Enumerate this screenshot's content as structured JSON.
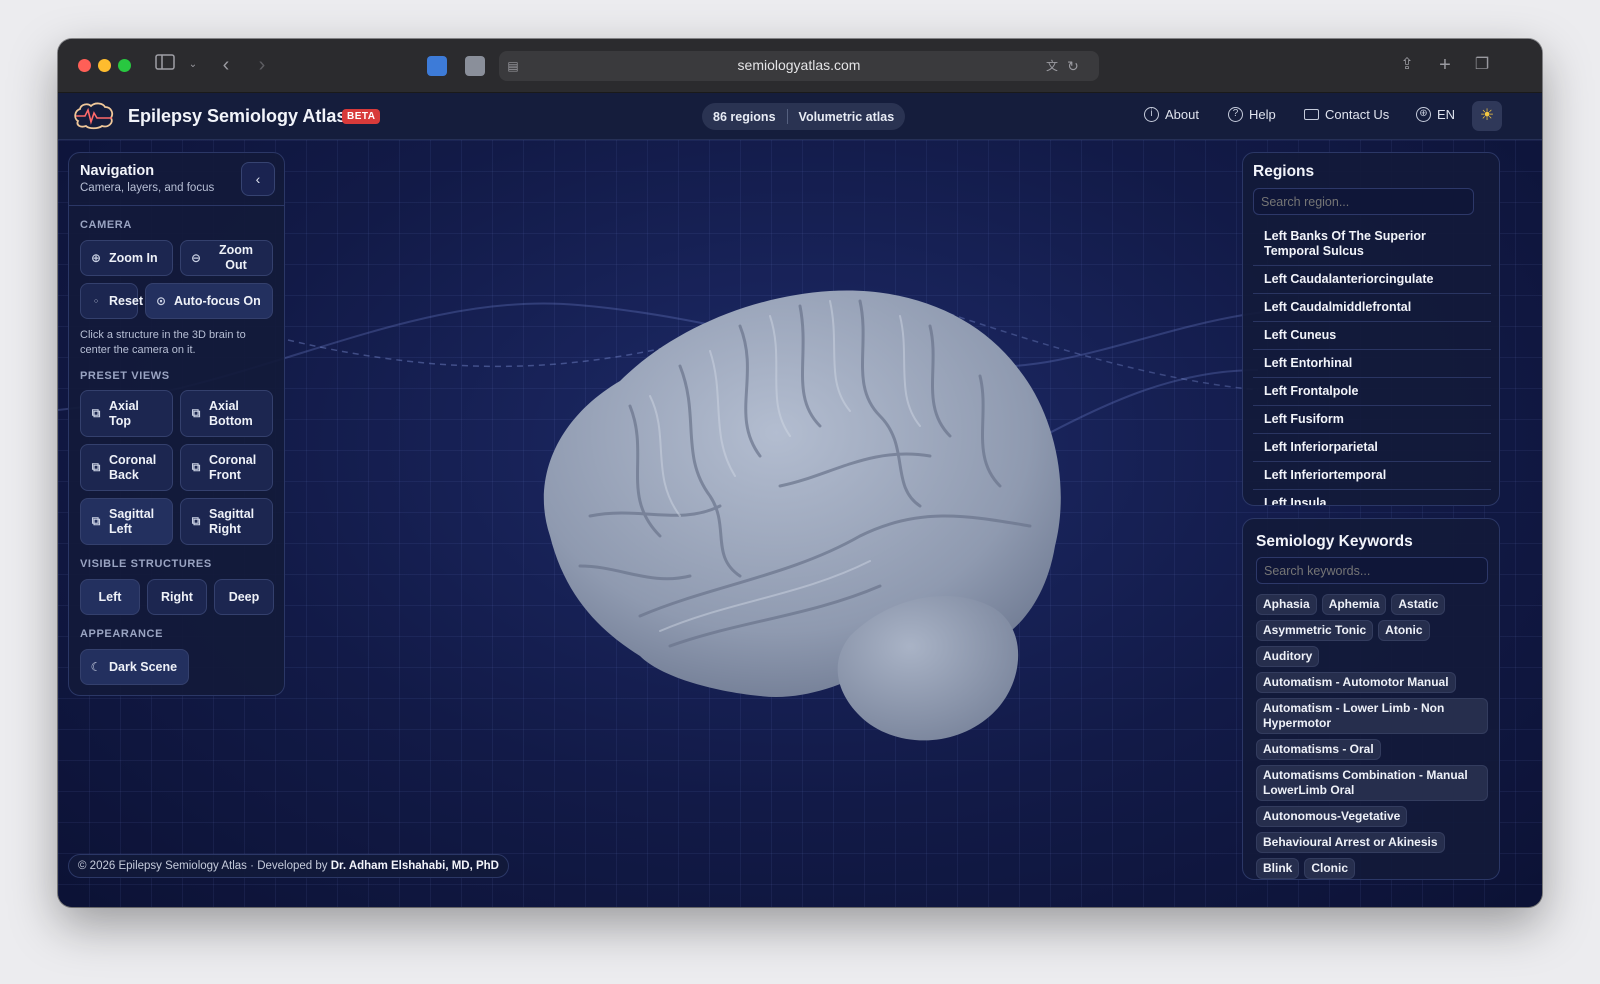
{
  "browser": {
    "url": "semiologyatlas.com"
  },
  "app": {
    "title": "Epilepsy Semiology Atlas",
    "badge": "BETA",
    "stats": {
      "regions": "86 regions",
      "mode": "Volumetric atlas"
    },
    "nav": {
      "about": "About",
      "help": "Help",
      "contact": "Contact Us",
      "language": "EN"
    }
  },
  "navigation_panel": {
    "title": "Navigation",
    "subtitle": "Camera, layers, and focus",
    "camera": {
      "label": "CAMERA",
      "zoom_in": "Zoom In",
      "zoom_out_1": "Zoom",
      "zoom_out_2": "Out",
      "reset": "Reset",
      "autofocus": "Auto-focus On",
      "hint": "Click a structure in the 3D brain to center the camera on it."
    },
    "preset_views": {
      "label": "PRESET VIEWS",
      "axial_top": [
        "Axial",
        "Top"
      ],
      "axial_bottom": [
        "Axial",
        "Bottom"
      ],
      "coronal_back": [
        "Coronal",
        "Back"
      ],
      "coronal_front": [
        "Coronal",
        "Front"
      ],
      "sagittal_left": [
        "Sagittal",
        "Left"
      ],
      "sagittal_right": [
        "Sagittal",
        "Right"
      ]
    },
    "visible_structures": {
      "label": "VISIBLE STRUCTURES",
      "left": "Left",
      "right": "Right",
      "deep": "Deep"
    },
    "appearance": {
      "label": "APPEARANCE",
      "dark_scene": "Dark Scene"
    }
  },
  "regions_panel": {
    "title": "Regions",
    "search_placeholder": "Search region...",
    "items": [
      "Left Banks Of The Superior Temporal Sulcus",
      "Left Caudalanteriorcingulate",
      "Left Caudalmiddlefrontal",
      "Left Cuneus",
      "Left Entorhinal",
      "Left Frontalpole",
      "Left Fusiform",
      "Left Inferiorparietal",
      "Left Inferiortemporal",
      "Left Insula"
    ]
  },
  "keywords_panel": {
    "title": "Semiology Keywords",
    "search_placeholder": "Search keywords...",
    "keywords": [
      "Aphasia",
      "Aphemia",
      "Astatic",
      "Asymmetric Tonic",
      "Atonic",
      "Auditory",
      "Automatism - Automotor Manual",
      "Automatism - Lower Limb - Non Hypermotor",
      "Automatisms - Oral",
      "Automatisms Combination - Manual LowerLimb Oral",
      "Autonomous-Vegetative",
      "Behavioural Arrest or Akinesis",
      "Blink",
      "Clonic"
    ]
  },
  "footer": {
    "copyright": "© 2026 Epilepsy Semiology Atlas",
    "dot": "·",
    "developed_by": "Developed by",
    "author": "Dr. Adham Elshahabi, MD, PhD"
  }
}
